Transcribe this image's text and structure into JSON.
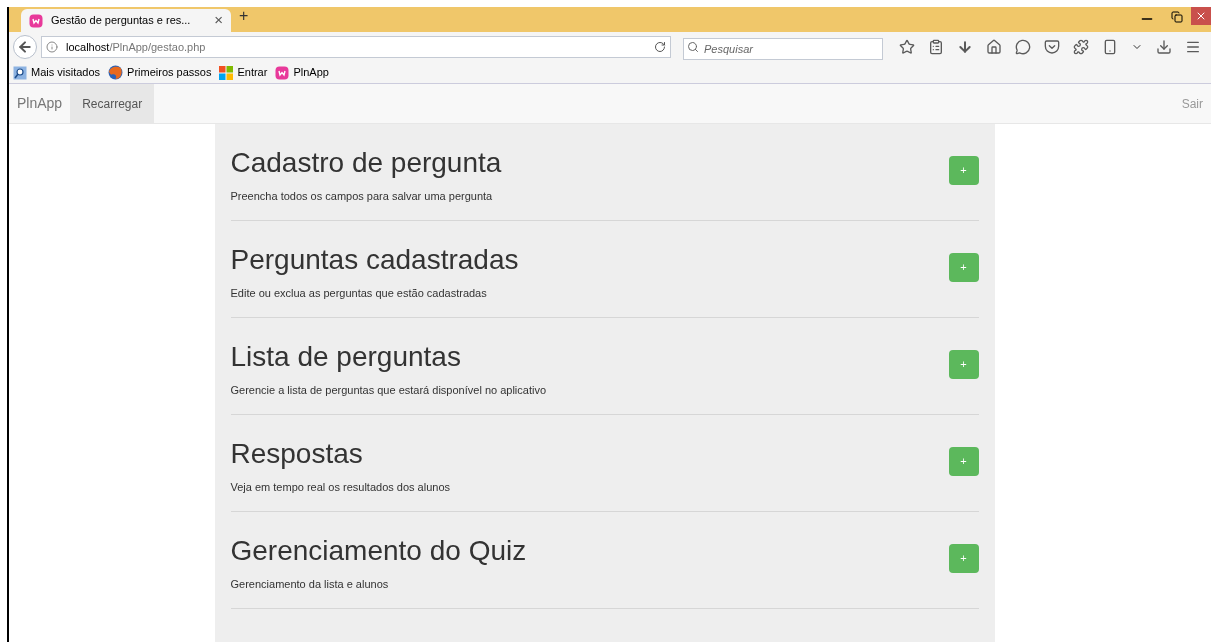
{
  "browser": {
    "tab": {
      "title": "Gestão de perguntas e res...",
      "close": "×",
      "selected": true
    },
    "new_tab": "+",
    "address": {
      "host": "localhost",
      "path": "/PlnApp/gestao.php"
    },
    "search": {
      "placeholder": "Pesquisar"
    },
    "bookmarks": [
      {
        "label": "Mais visitados",
        "kind": "search"
      },
      {
        "label": "Primeiros passos",
        "kind": "firefox"
      },
      {
        "label": "Entrar",
        "kind": "windows"
      },
      {
        "label": "PlnApp",
        "kind": "app"
      }
    ]
  },
  "navbar": {
    "brand": "PlnApp",
    "items": [
      {
        "label": "Recarregar",
        "selected": true
      }
    ],
    "logout": "Sair"
  },
  "sections": [
    {
      "title": "Cadastro de pergunta",
      "description": "Preencha todos os campos para salvar uma pergunta",
      "button": "+"
    },
    {
      "title": "Perguntas cadastradas",
      "description": "Edite ou exclua as perguntas que estão cadastradas",
      "button": "+"
    },
    {
      "title": "Lista de perguntas",
      "description": "Gerencie a lista de perguntas que estará disponível no aplicativo",
      "button": "+"
    },
    {
      "title": "Respostas",
      "description": "Veja em tempo real os resultados dos alunos",
      "button": "+"
    },
    {
      "title": "Gerenciamento do Quiz",
      "description": "Gerenciamento da lista e alunos",
      "button": "+"
    }
  ]
}
